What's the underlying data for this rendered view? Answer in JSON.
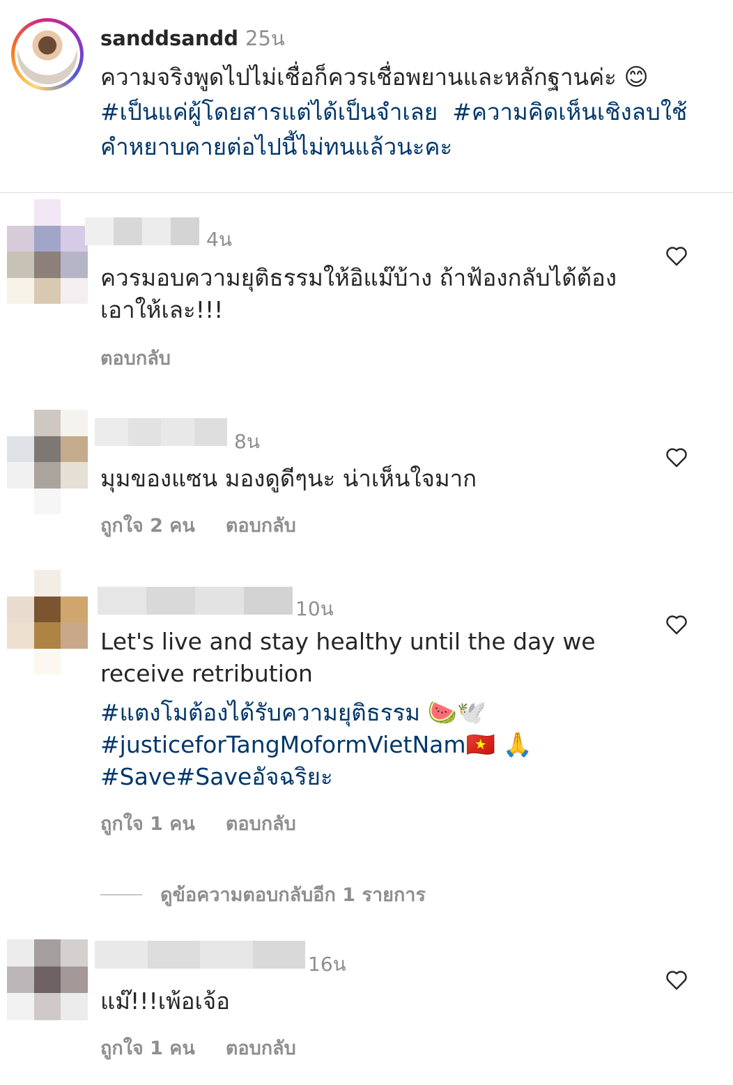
{
  "caption": {
    "username": "sanddsandd",
    "time": "25น",
    "text": "ความจริงพูดไปไม่เชื่อก็ควรเชื่อพยานและหลักฐานค่ะ",
    "emoji": "😊",
    "tags": [
      "#เป็นแค่ผู้โดยสารแต่ได้เป็นจำเลย",
      "#ความคิดเห็นเชิงลบใช้คำหยาบคายต่อไปนี้ไม่ทนแล้วนะคะ"
    ]
  },
  "comments": [
    {
      "time": "4น",
      "text": "ควรมอบความยุติธรรมให้อิแม๊บ้าง ถ้าฟ้องกลับได้ต้องเอาให้เละ!!!",
      "reply": "ตอบกลับ"
    },
    {
      "time": "8น",
      "text": "มุมของแซน มองดูดีๆนะ น่าเห็นใจมาก",
      "likes": "ถูกใจ 2 คน",
      "reply": "ตอบกลับ"
    },
    {
      "time": "10น",
      "text": "Let's live and stay healthy until the day we receive retribution",
      "tag1": "#แตงโมต้องได้รับความยุติธรรม",
      "tag1_emoji": "🍉🕊️",
      "tag2": "#justiceforTangMoformVietNam",
      "tag2_emoji": "🇻🇳 🙏",
      "tag3": "#Save#Saveอัจฉริยะ",
      "likes": "ถูกใจ 1 คน",
      "reply": "ตอบกลับ"
    },
    {
      "time": "16น",
      "text": "แม๊!!!เพ้อเจ้อ",
      "likes": "ถูกใจ 1 คน",
      "reply": "ตอบกลับ"
    }
  ],
  "view_more_replies": "ดูข้อความตอบกลับอีก 1 รายการ",
  "colors": {
    "hashtag": "#00376b",
    "secondary": "#8e8e8e",
    "text": "#262626"
  }
}
